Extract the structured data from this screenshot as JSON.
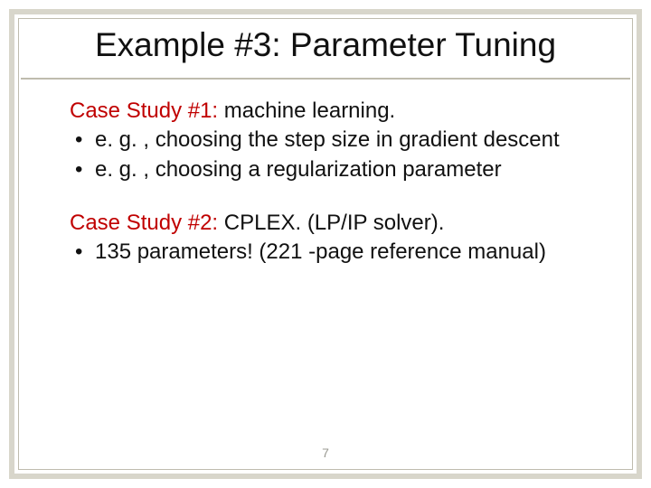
{
  "title": "Example #3:  Parameter Tuning",
  "case1": {
    "label": "Case Study #1:",
    "rest": " machine learning.",
    "bullets": [
      "e. g. , choosing the step size in gradient descent",
      "e. g. , choosing a regularization parameter"
    ]
  },
  "case2": {
    "label": "Case Study #2:",
    "rest": " CPLEX. (LP/IP solver).",
    "bullets": [
      "135 parameters!  (221 -page reference manual)"
    ]
  },
  "page_number": "7"
}
